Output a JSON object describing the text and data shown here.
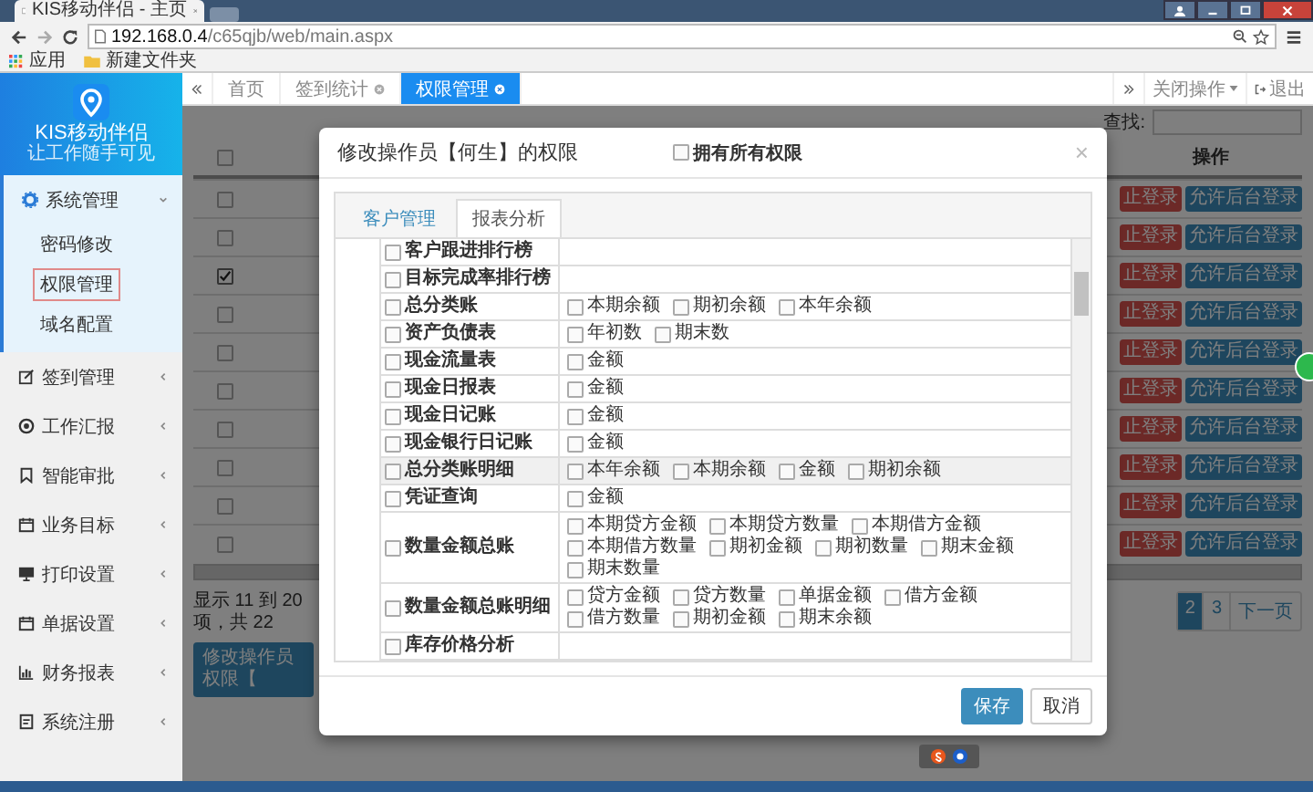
{
  "browser": {
    "tab_title": "KIS移动伴侣 - 主页",
    "url_host": "192.168.0.4",
    "url_path": "/c65qjb/web/main.aspx",
    "bookmarks": [
      {
        "kind": "apps",
        "label": "应用"
      },
      {
        "kind": "folder",
        "label": "新建文件夹"
      }
    ]
  },
  "sidebar": {
    "logo_title": "KIS移动伴侣",
    "logo_subtitle": "让工作随手可见",
    "menu": [
      {
        "label": "系统管理",
        "kind": "gear",
        "expanded": true,
        "children": [
          {
            "label": "密码修改",
            "selected": false
          },
          {
            "label": "权限管理",
            "selected": true
          },
          {
            "label": "域名配置",
            "selected": false
          }
        ]
      },
      {
        "label": "签到管理",
        "kind": "edit",
        "expanded": false
      },
      {
        "label": "工作汇报",
        "kind": "target",
        "expanded": false
      },
      {
        "label": "智能审批",
        "kind": "bookmark",
        "expanded": false
      },
      {
        "label": "业务目标",
        "kind": "calendar",
        "expanded": false
      },
      {
        "label": "打印设置",
        "kind": "monitor",
        "expanded": false
      },
      {
        "label": "单据设置",
        "kind": "calendar",
        "expanded": false
      },
      {
        "label": "财务报表",
        "kind": "chart",
        "expanded": false
      },
      {
        "label": "系统注册",
        "kind": "document",
        "expanded": false
      }
    ]
  },
  "tabs": {
    "items": [
      {
        "label": "首页",
        "closable": false,
        "selected": false
      },
      {
        "label": "签到统计",
        "closable": true,
        "selected": false
      },
      {
        "label": "权限管理",
        "closable": true,
        "selected": true
      }
    ],
    "close_ops": "关闭操作",
    "logout": "退出"
  },
  "background": {
    "search_label": "查找:",
    "action_header": "操作",
    "header_checked": false,
    "rows": [
      {
        "checked": false,
        "disable_button": "止登录",
        "allow_button": "允许后台登录"
      },
      {
        "checked": false,
        "disable_button": "止登录",
        "allow_button": "允许后台登录"
      },
      {
        "checked": true,
        "disable_button": "止登录",
        "allow_button": "允许后台登录"
      },
      {
        "checked": false,
        "disable_button": "止登录",
        "allow_button": "允许后台登录"
      },
      {
        "checked": false,
        "disable_button": "止登录",
        "allow_button": "允许后台登录"
      },
      {
        "checked": false,
        "disable_button": "止登录",
        "allow_button": "允许后台登录"
      },
      {
        "checked": false,
        "disable_button": "止登录",
        "allow_button": "允许后台登录"
      },
      {
        "checked": false,
        "disable_button": "止登录",
        "allow_button": "允许后台登录"
      },
      {
        "checked": false,
        "disable_button": "止登录",
        "allow_button": "允许后台登录"
      },
      {
        "checked": false,
        "disable_button": "止登录",
        "allow_button": "允许后台登录"
      }
    ],
    "footer_info": "显示 11 到 20 项，共 22",
    "pages": [
      {
        "label": "2",
        "selected": true
      },
      {
        "label": "3",
        "selected": false
      },
      {
        "label": "下一页",
        "selected": false
      }
    ],
    "action_button": "修改操作员权限【"
  },
  "modal": {
    "title": "修改操作员【何生】的权限",
    "all_permissions": {
      "label": "拥有所有权限",
      "checked": false
    },
    "close": "×",
    "tabs": [
      {
        "label": "客户管理",
        "selected": false
      },
      {
        "label": "报表分析",
        "selected": true
      }
    ],
    "rows": [
      {
        "name": "客户跟进排行榜",
        "checked": false,
        "highlighted": false,
        "options": []
      },
      {
        "name": "目标完成率排行榜",
        "checked": false,
        "highlighted": false,
        "options": []
      },
      {
        "name": "总分类账",
        "checked": false,
        "highlighted": false,
        "options": [
          {
            "label": "本期余额",
            "checked": false
          },
          {
            "label": "期初余额",
            "checked": false
          },
          {
            "label": "本年余额",
            "checked": false
          }
        ]
      },
      {
        "name": "资产负债表",
        "checked": false,
        "highlighted": false,
        "options": [
          {
            "label": "年初数",
            "checked": false
          },
          {
            "label": "期末数",
            "checked": false
          }
        ]
      },
      {
        "name": "现金流量表",
        "checked": false,
        "highlighted": false,
        "options": [
          {
            "label": "金额",
            "checked": false
          }
        ]
      },
      {
        "name": "现金日报表",
        "checked": false,
        "highlighted": false,
        "options": [
          {
            "label": "金额",
            "checked": false
          }
        ]
      },
      {
        "name": "现金日记账",
        "checked": false,
        "highlighted": false,
        "options": [
          {
            "label": "金额",
            "checked": false
          }
        ]
      },
      {
        "name": "现金银行日记账",
        "checked": false,
        "highlighted": false,
        "options": [
          {
            "label": "金额",
            "checked": false
          }
        ]
      },
      {
        "name": "总分类账明细",
        "checked": false,
        "highlighted": true,
        "options": [
          {
            "label": "本年余额",
            "checked": false
          },
          {
            "label": "本期余额",
            "checked": false
          },
          {
            "label": "金额",
            "checked": false
          },
          {
            "label": "期初余额",
            "checked": false
          }
        ]
      },
      {
        "name": "凭证查询",
        "checked": false,
        "highlighted": false,
        "options": [
          {
            "label": "金额",
            "checked": false
          }
        ]
      },
      {
        "name": "数量金额总账",
        "checked": false,
        "highlighted": false,
        "options": [
          {
            "label": "本期贷方金额",
            "checked": false
          },
          {
            "label": "本期贷方数量",
            "checked": false
          },
          {
            "label": "本期借方金额",
            "checked": false
          },
          {
            "label": "本期借方数量",
            "checked": false
          },
          {
            "label": "期初金额",
            "checked": false
          },
          {
            "label": "期初数量",
            "checked": false
          },
          {
            "label": "期末金额",
            "checked": false
          },
          {
            "label": "期末数量",
            "checked": false
          }
        ]
      },
      {
        "name": "数量金额总账明细",
        "checked": false,
        "highlighted": false,
        "options": [
          {
            "label": "贷方金额",
            "checked": false
          },
          {
            "label": "贷方数量",
            "checked": false
          },
          {
            "label": "单据金额",
            "checked": false
          },
          {
            "label": "借方金额",
            "checked": false
          },
          {
            "label": "借方数量",
            "checked": false
          },
          {
            "label": "期初金额",
            "checked": false
          },
          {
            "label": "期末余额",
            "checked": false
          }
        ]
      },
      {
        "name": "库存价格分析",
        "checked": false,
        "highlighted": false,
        "options": []
      }
    ],
    "save": "保存",
    "cancel": "取消"
  }
}
